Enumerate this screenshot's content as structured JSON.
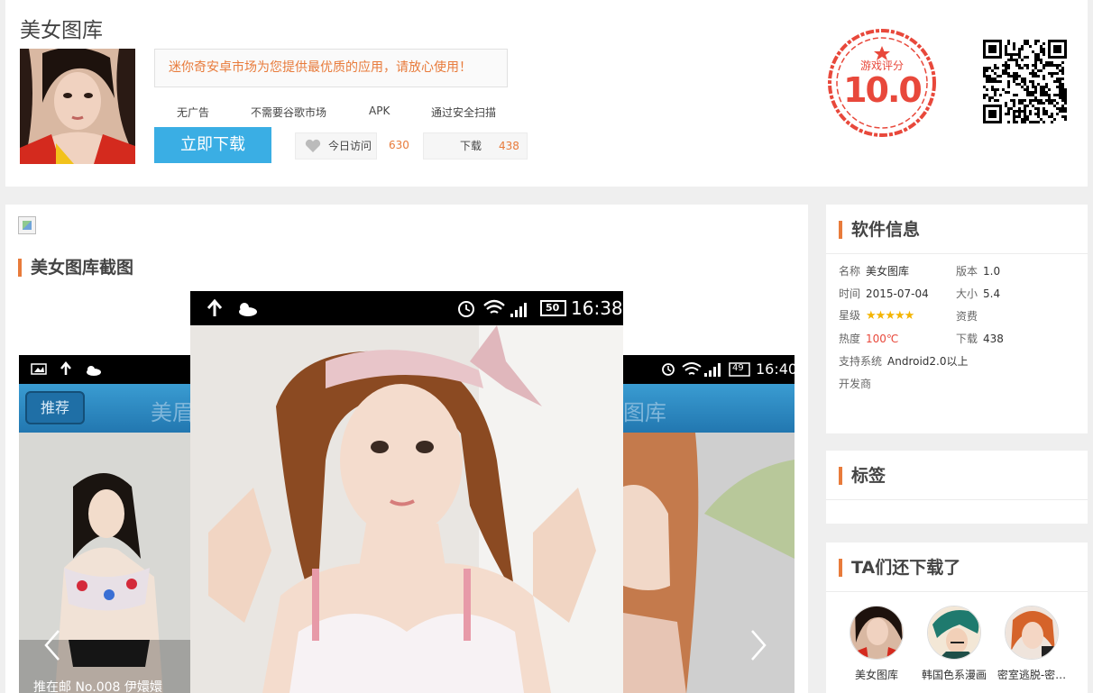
{
  "header": {
    "title": "美女图库",
    "notice": "迷你奇安卓市场为您提供最优质的应用，请放心使用！",
    "features": [
      "无广告",
      "不需要谷歌市场",
      "APK",
      "通过安全扫描"
    ],
    "download_label": "立即下载",
    "visits_label": "今日访问",
    "visits_count": "630",
    "downloads_label": "下载",
    "downloads_count": "438",
    "rating_label": "游戏评分",
    "rating_value": "10.0",
    "colors": {
      "accent": "#e87b3b",
      "button": "#3aaee4",
      "stamp": "#e8483b"
    }
  },
  "screenshots": {
    "title": "美女图库截图",
    "left_tab": "推荐",
    "left_appbar": "美眉",
    "right_appbar": "图库",
    "main_time": "16:38",
    "main_battery": "50",
    "right_time": "16:40",
    "right_battery": "49",
    "left_caption": "推在邮 No.008 伊嬛嬛"
  },
  "sidebar": {
    "info_title": "软件信息",
    "info": {
      "name_k": "名称",
      "name_v": "美女图库",
      "version_k": "版本",
      "version_v": "1.0",
      "time_k": "时间",
      "time_v": "2015-07-04",
      "size_k": "大小",
      "size_v": "5.4",
      "stars_k": "星级",
      "stars_v": "★★★★★",
      "stars_value": 5,
      "fee_k": "资费",
      "heat_k": "热度",
      "heat_v": "100℃",
      "dl_k": "下载",
      "dl_v": "438",
      "os_k": "支持系统",
      "os_v": "Android2.0以上",
      "dev_k": "开发商"
    },
    "tags_title": "标签",
    "related_title": "TA们还下载了",
    "related": [
      {
        "name": "美女图库"
      },
      {
        "name": "韩国色系漫画"
      },
      {
        "name": "密室逃脱-密…"
      }
    ]
  }
}
